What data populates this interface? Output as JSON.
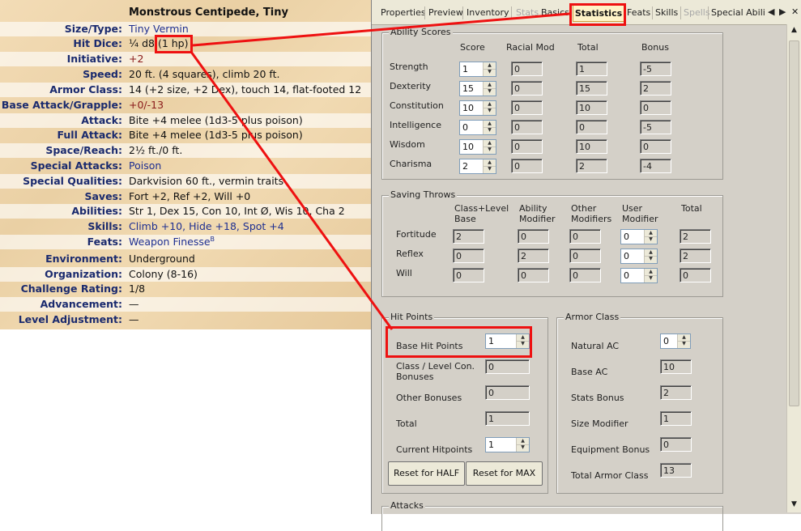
{
  "statblock": {
    "title": "Monstrous Centipede, Tiny",
    "rows": [
      {
        "label": "Size/Type:",
        "value": "Tiny Vermin"
      },
      {
        "label": "Hit Dice:",
        "value": "¼ d8 (1 hp)"
      },
      {
        "label": "Initiative:",
        "value": "+2"
      },
      {
        "label": "Speed:",
        "value": "20 ft. (4 squares), climb 20 ft."
      },
      {
        "label": "Armor Class:",
        "value": "14 (+2 size, +2 Dex), touch 14, flat-footed 12"
      },
      {
        "label": "Base Attack/Grapple:",
        "value": "+0/-13"
      },
      {
        "label": "Attack:",
        "value": "Bite +4 melee (1d3-5 plus poison)"
      },
      {
        "label": "Full Attack:",
        "value": "Bite +4 melee (1d3-5 plus poison)"
      },
      {
        "label": "Space/Reach:",
        "value": "2½ ft./0 ft."
      },
      {
        "label": "Special Attacks:",
        "value": "Poison"
      },
      {
        "label": "Special Qualities:",
        "value": "Darkvision 60 ft., vermin traits"
      },
      {
        "label": "Saves:",
        "value": "Fort +2, Ref +2, Will +0"
      },
      {
        "label": "Abilities:",
        "value": "Str 1, Dex 15, Con 10, Int Ø, Wis 10, Cha 2"
      },
      {
        "label": "Skills:",
        "value": "Climb +10, Hide +18, Spot +4"
      },
      {
        "label": "Feats:",
        "value": "Weapon Finesse",
        "sup": "B"
      },
      {
        "label": "Environment:",
        "value": "Underground"
      },
      {
        "label": "Organization:",
        "value": "Colony (8-16)"
      },
      {
        "label": "Challenge Rating:",
        "value": "1/8"
      },
      {
        "label": "Advancement:",
        "value": "—"
      },
      {
        "label": "Level Adjustment:",
        "value": "—"
      }
    ]
  },
  "window": {
    "tabs": [
      "Properties",
      "Preview",
      "Inventory",
      "Stats",
      "Basics",
      "Statistics",
      "Feats",
      "Skills",
      "Spells",
      "Special Abili"
    ],
    "active_tab": "Statistics",
    "ability_scores": {
      "title": "Ability Scores",
      "headers": [
        "Score",
        "Racial Mod",
        "Total",
        "Bonus"
      ],
      "rows": [
        {
          "name": "Strength",
          "score": "1",
          "racial": "0",
          "total": "1",
          "bonus": "-5"
        },
        {
          "name": "Dexterity",
          "score": "15",
          "racial": "0",
          "total": "15",
          "bonus": "2"
        },
        {
          "name": "Constitution",
          "score": "10",
          "racial": "0",
          "total": "10",
          "bonus": "0"
        },
        {
          "name": "Intelligence",
          "score": "0",
          "racial": "0",
          "total": "0",
          "bonus": "-5"
        },
        {
          "name": "Wisdom",
          "score": "10",
          "racial": "0",
          "total": "10",
          "bonus": "0"
        },
        {
          "name": "Charisma",
          "score": "2",
          "racial": "0",
          "total": "2",
          "bonus": "-4"
        }
      ]
    },
    "saving_throws": {
      "title": "Saving Throws",
      "headers": [
        "Class+Level\nBase",
        "Ability\nModifier",
        "Other\nModifiers",
        "User\nModifier",
        "Total"
      ],
      "rows": [
        {
          "name": "Fortitude",
          "base": "2",
          "ability": "0",
          "other": "0",
          "user": "0",
          "total": "2"
        },
        {
          "name": "Reflex",
          "base": "0",
          "ability": "2",
          "other": "0",
          "user": "0",
          "total": "2"
        },
        {
          "name": "Will",
          "base": "0",
          "ability": "0",
          "other": "0",
          "user": "0",
          "total": "0"
        }
      ]
    },
    "hit_points": {
      "title": "Hit Points",
      "base_label": "Base Hit Points",
      "base": "1",
      "class_label": "Class / Level Con.\nBonuses",
      "class": "0",
      "other_label": "Other Bonuses",
      "other": "0",
      "total_label": "Total",
      "total": "1",
      "current_label": "Current Hitpoints",
      "current": "1",
      "reset_half": "Reset for HALF",
      "reset_max": "Reset for MAX"
    },
    "armor_class": {
      "title": "Armor Class",
      "natural_label": "Natural AC",
      "natural": "0",
      "base_label": "Base AC",
      "base": "10",
      "stats_label": "Stats Bonus",
      "stats": "2",
      "size_label": "Size Modifier",
      "size": "1",
      "equip_label": "Equipment Bonus",
      "equip": "0",
      "total_label": "Total Armor Class",
      "total": "13"
    },
    "attacks_title": "Attacks"
  },
  "colors": {
    "highlight": "#ee1111",
    "link": "#1e2f91",
    "label": "#1a2a6e"
  }
}
